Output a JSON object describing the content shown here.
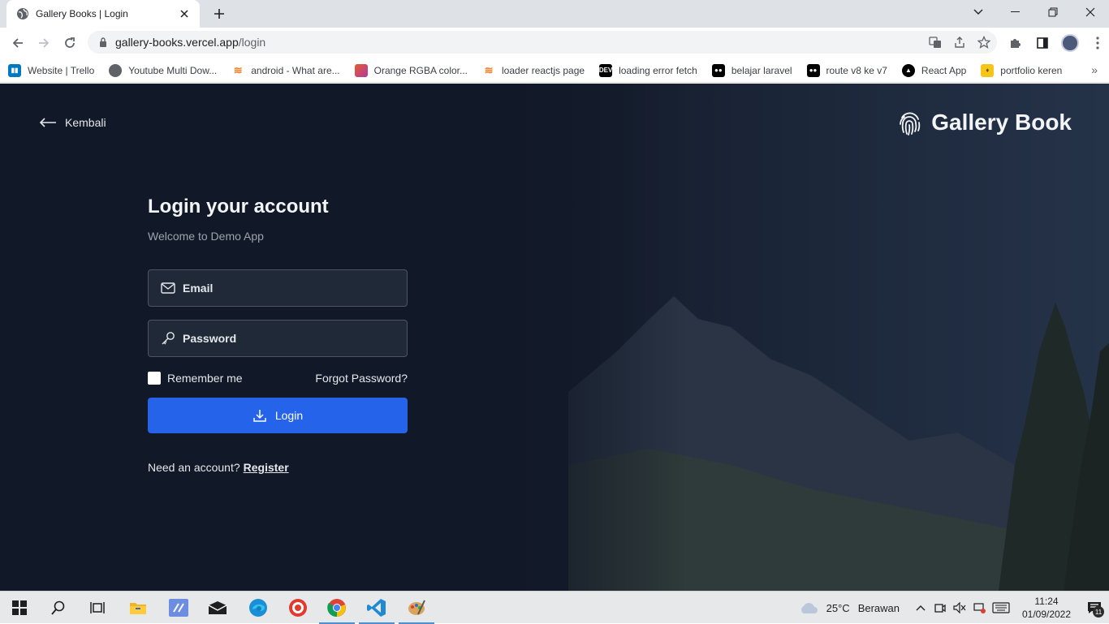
{
  "browser": {
    "tab_title": "Gallery Books | Login",
    "url_host": "gallery-books.vercel.app",
    "url_path": "/login",
    "bookmarks": [
      {
        "label": "Website | Trello",
        "icon": "trello-icon",
        "color": "#0079bf"
      },
      {
        "label": "Youtube Multi Dow...",
        "icon": "globe-icon",
        "color": "#5f6368"
      },
      {
        "label": "android - What are...",
        "icon": "stackoverflow-icon",
        "color": "#f48024"
      },
      {
        "label": "Orange RGBA color...",
        "icon": "color-icon",
        "color": "#e85a2c"
      },
      {
        "label": "loader reactjs page",
        "icon": "stackoverflow-icon",
        "color": "#f48024"
      },
      {
        "label": "loading error fetch",
        "icon": "dev-icon",
        "color": "#000000"
      },
      {
        "label": "belajar laravel",
        "icon": "medium-icon",
        "color": "#000000"
      },
      {
        "label": "route v8 ke v7",
        "icon": "medium-icon",
        "color": "#000000"
      },
      {
        "label": "React App",
        "icon": "vercel-icon",
        "color": "#000000"
      },
      {
        "label": "portfolio keren",
        "icon": "shield-icon",
        "color": "#f5c518"
      }
    ]
  },
  "page": {
    "back_label": "Kembali",
    "brand_name": "Gallery Book",
    "login": {
      "title": "Login your account",
      "subtitle": "Welcome to Demo App",
      "email_placeholder": "Email",
      "password_placeholder": "Password",
      "remember_label": "Remember me",
      "forgot_label": "Forgot Password?",
      "submit_label": "Login",
      "register_prompt": "Need an account?",
      "register_label": "Register"
    },
    "colors": {
      "background": "#111827",
      "primary": "#2563eb",
      "field_bg": "#1f2937"
    }
  },
  "taskbar": {
    "weather_temp": "25°C",
    "weather_desc": "Berawan",
    "time": "11:24",
    "date": "01/09/2022",
    "notification_count": "11"
  }
}
